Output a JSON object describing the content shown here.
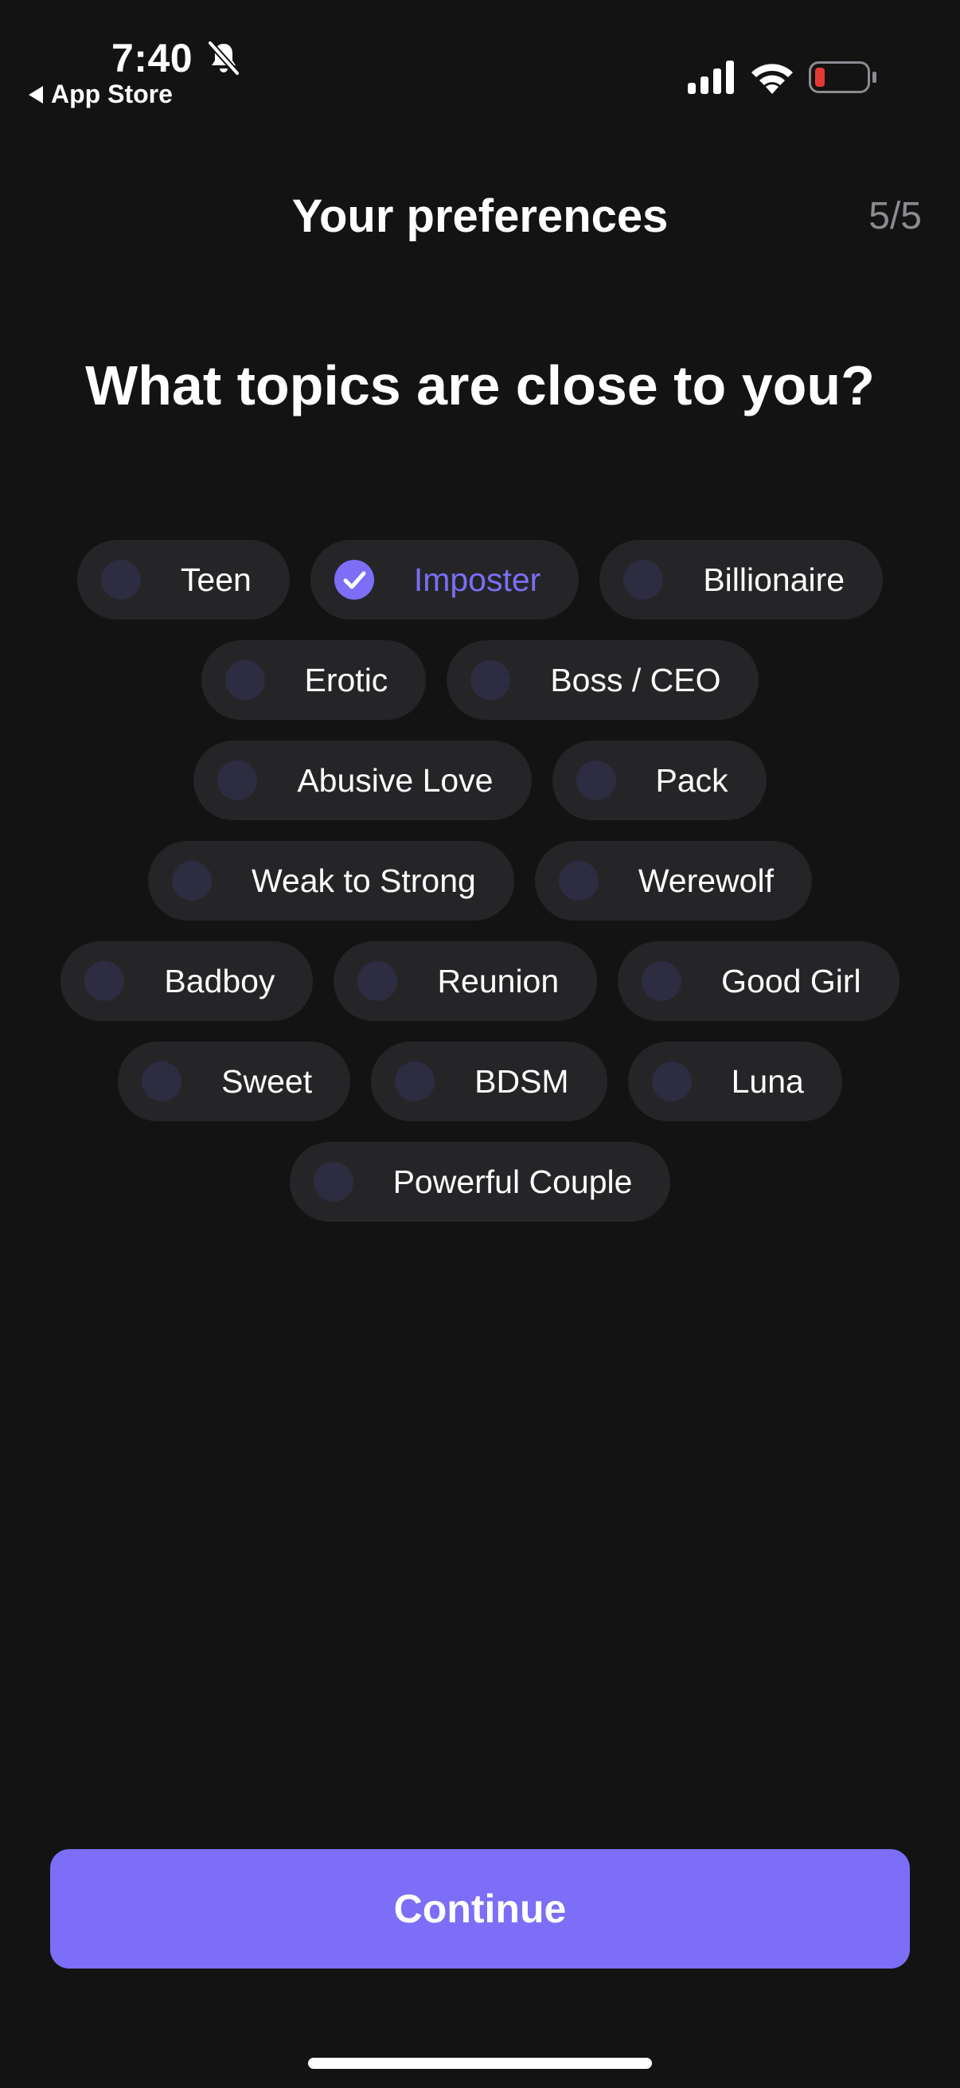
{
  "status_bar": {
    "time": "7:40",
    "back_label": "App Store",
    "icons": [
      "bell-slash-icon",
      "cellular-signal-icon",
      "wifi-icon",
      "battery-low-icon"
    ]
  },
  "header": {
    "title": "Your preferences",
    "step": "5/5"
  },
  "question": "What topics are close to you?",
  "topics": {
    "rows": [
      [
        {
          "label": "Teen",
          "selected": false
        },
        {
          "label": "Imposter",
          "selected": true
        },
        {
          "label": "Billionaire",
          "selected": false
        }
      ],
      [
        {
          "label": "Erotic",
          "selected": false
        },
        {
          "label": "Boss / CEO",
          "selected": false
        }
      ],
      [
        {
          "label": "Abusive Love",
          "selected": false
        },
        {
          "label": "Pack",
          "selected": false
        }
      ],
      [
        {
          "label": "Weak to Strong",
          "selected": false
        },
        {
          "label": "Werewolf",
          "selected": false
        }
      ],
      [
        {
          "label": "Badboy",
          "selected": false
        },
        {
          "label": "Reunion",
          "selected": false
        },
        {
          "label": "Good Girl",
          "selected": false
        }
      ],
      [
        {
          "label": "Sweet",
          "selected": false
        },
        {
          "label": "BDSM",
          "selected": false
        },
        {
          "label": "Luna",
          "selected": false
        }
      ],
      [
        {
          "label": "Powerful Couple",
          "selected": false
        }
      ]
    ]
  },
  "continue_label": "Continue",
  "colors": {
    "background": "#131314",
    "chip_background": "#252528",
    "accent": "#7c6ef6",
    "muted_text": "#8b8b90",
    "battery_low": "#e53935"
  }
}
